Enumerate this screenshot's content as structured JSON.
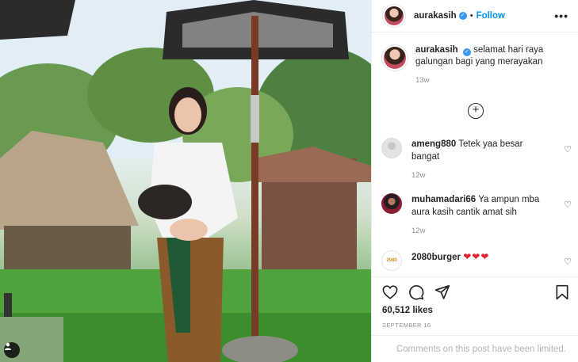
{
  "post": {
    "author": {
      "username": "aurakasih",
      "verified": true,
      "follow_label": "Follow",
      "separator": "•"
    },
    "caption": {
      "username": "aurakasih",
      "text": "selamat hari raya galungan bagi yang merayakan",
      "time": "13w"
    },
    "load_more_label": "+",
    "comments": [
      {
        "username": "ameng880",
        "text": "Tetek yaa besar bangat",
        "time": "12w",
        "avatar": "grey-default-avatar"
      },
      {
        "username": "muhamadari66",
        "text": "Ya ampun mba aura kasih cantik amat sih",
        "time": "12w",
        "avatar": "user-photo-avatar"
      },
      {
        "username": "2080burger",
        "text": "❤❤❤",
        "avatar": "brand-logo-avatar",
        "logo_text": "2080"
      }
    ],
    "likes": "60,512 likes",
    "date": "SEPTEMBER 16",
    "comments_limited": "Comments on this post have been limited.",
    "more_icon": "•••"
  },
  "theme": {
    "accent": "#0095f6",
    "verified": "#3897f0",
    "heart_red": "#e0242e",
    "muted": "#8e8e8e"
  }
}
